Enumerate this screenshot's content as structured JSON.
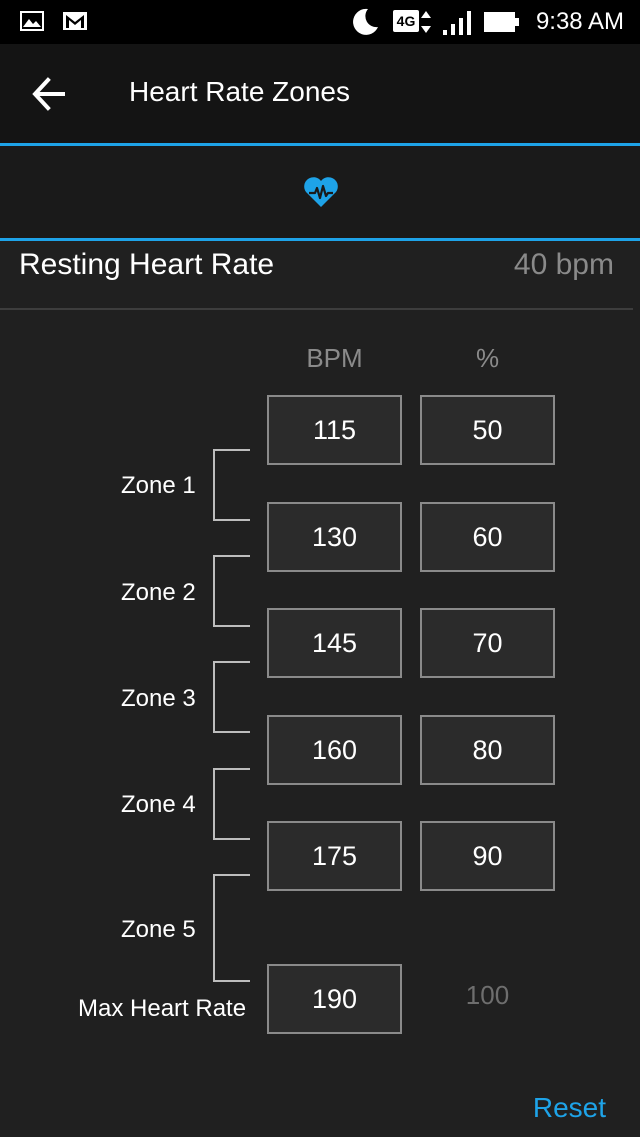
{
  "status_bar": {
    "time": "9:38 AM",
    "network": "4G",
    "icons": [
      "gallery-icon",
      "gmail-icon",
      "moon-icon",
      "network-4g-icon",
      "signal-icon",
      "battery-icon"
    ]
  },
  "app_bar": {
    "title": "Heart Rate Zones",
    "back_icon": "back-arrow-icon"
  },
  "tab": {
    "icon": "heart-rate-icon",
    "accent": "#1ea3e8"
  },
  "resting": {
    "label": "Resting Heart Rate",
    "value": "40 bpm"
  },
  "columns": {
    "bpm": "BPM",
    "percent": "%"
  },
  "thresholds": [
    {
      "bpm": "115",
      "percent": "50"
    },
    {
      "bpm": "130",
      "percent": "60"
    },
    {
      "bpm": "145",
      "percent": "70"
    },
    {
      "bpm": "160",
      "percent": "80"
    },
    {
      "bpm": "175",
      "percent": "90"
    }
  ],
  "zones": [
    "Zone 1",
    "Zone 2",
    "Zone 3",
    "Zone 4",
    "Zone 5"
  ],
  "max": {
    "label": "Max Heart Rate",
    "bpm": "190",
    "percent": "100"
  },
  "reset_label": "Reset"
}
